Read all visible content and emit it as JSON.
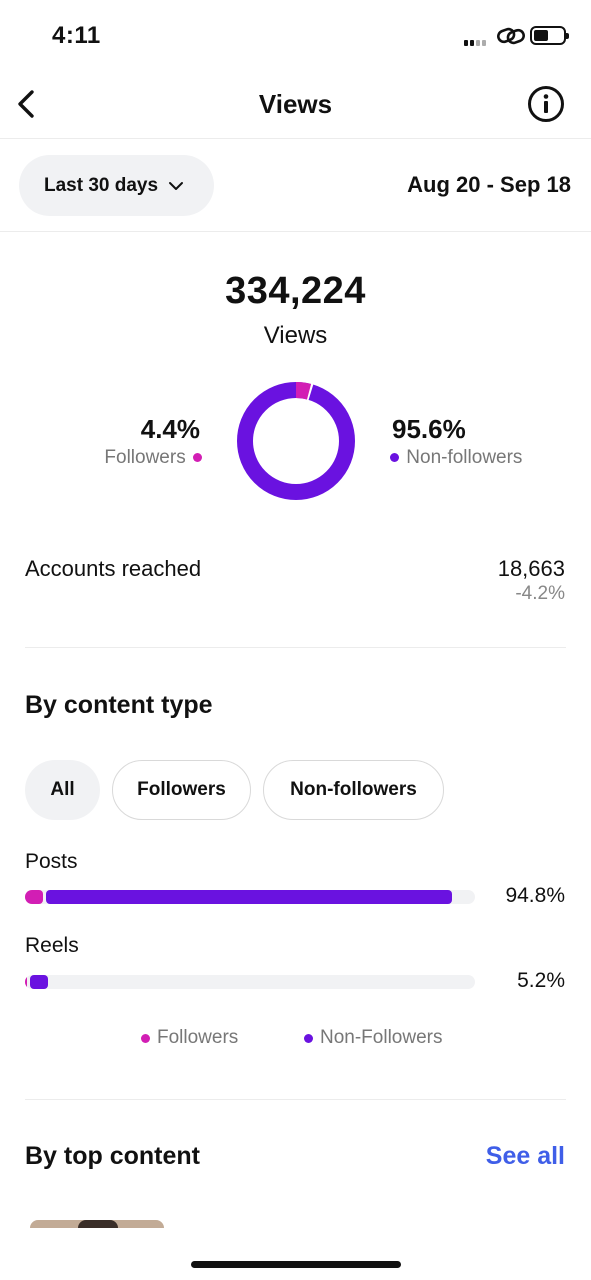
{
  "status_bar": {
    "time": "4:11"
  },
  "header": {
    "title": "Views",
    "back_icon": "chevron-left-icon",
    "info_icon": "info-icon"
  },
  "filter": {
    "range_label": "Last 30 days",
    "date_range": "Aug 20 - Sep 18"
  },
  "summary": {
    "total": "334,224",
    "total_label": "Views",
    "followers_pct": "4.4%",
    "followers_label": "Followers",
    "non_followers_pct": "95.6%",
    "non_followers_label": "Non-followers",
    "followers_fraction": 0.044
  },
  "colors": {
    "followers": "#d21eb4",
    "non_followers": "#6a12e0",
    "link": "#3f5ee8"
  },
  "reach": {
    "label": "Accounts reached",
    "value": "18,663",
    "change": "-4.2%"
  },
  "by_content_type": {
    "heading": "By content type",
    "chips": [
      "All",
      "Followers",
      "Non-followers"
    ],
    "rows": [
      {
        "label": "Posts",
        "pct": "94.8%",
        "total": 0.948,
        "followers": 0.04
      },
      {
        "label": "Reels",
        "pct": "5.2%",
        "total": 0.052,
        "followers": 0.004
      }
    ],
    "legend": [
      "Followers",
      "Non-Followers"
    ]
  },
  "top_content": {
    "heading": "By top content",
    "see_all": "See all"
  }
}
